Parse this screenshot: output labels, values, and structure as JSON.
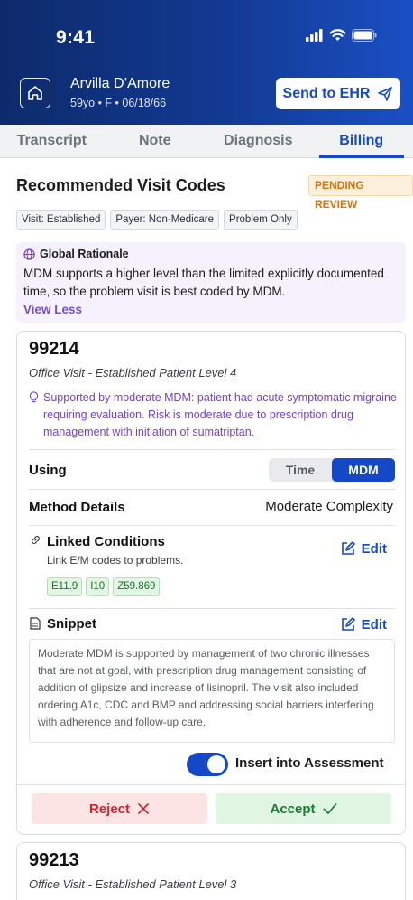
{
  "status_bar": {
    "time": "9:41"
  },
  "patient": {
    "name": "Arvilla D’Amore",
    "meta": "59yo • F • 06/18/66"
  },
  "header": {
    "send_label": "Send to EHR"
  },
  "tabs": [
    {
      "label": "Transcript"
    },
    {
      "label": "Note"
    },
    {
      "label": "Diagnosis"
    },
    {
      "label": "Billing"
    }
  ],
  "section": {
    "title": "Recommended Visit Codes",
    "badge": "PENDING REVIEW"
  },
  "tags": [
    "Visit: Established",
    "Payer: Non-Medicare",
    "Problem Only"
  ],
  "rationale": {
    "title": "Global Rationale",
    "text": "MDM supports a higher level than the limited explicitly documented time, so the problem visit is best coded by MDM.",
    "toggle_label": "View Less"
  },
  "cards": [
    {
      "code": "99214",
      "description": "Office Visit - Established Patient Level 4",
      "support": "Supported by moderate MDM: patient had acute symptomatic migraine requiring evaluation. Risk is moderate due to prescription drug management with initiation of sumatriptan.",
      "using_label": "Using",
      "using_options": [
        "Time",
        "MDM"
      ],
      "method_label": "Method Details",
      "method_value": "Moderate Complexity",
      "linked_title": "Linked Conditions",
      "linked_note": "Link E/M codes to problems.",
      "edit_label": "Edit",
      "conditions": [
        "E11.9",
        "I10",
        "Z59.869"
      ],
      "snippet_title": "Snippet",
      "snippet_text": "Moderate MDM is supported by management of two chronic illnesses that are not at goal, with prescription drug management consisting of addition of glipsize and increase of lisinopril. The visit also included ordering A1c, CDC and BMP and addressing social barriers interfering with adherence and follow-up care.",
      "insert_label": "Insert into Assessment",
      "reject_label": "Reject",
      "accept_label": "Accept"
    },
    {
      "code": "99213",
      "description": "Office Visit - Established Patient Level 3"
    }
  ],
  "colors": {
    "primary": "#1547c9",
    "pending": "#d4740a",
    "support": "#7a3fd0",
    "reject": "#d0232e",
    "accept": "#1d7a31"
  }
}
